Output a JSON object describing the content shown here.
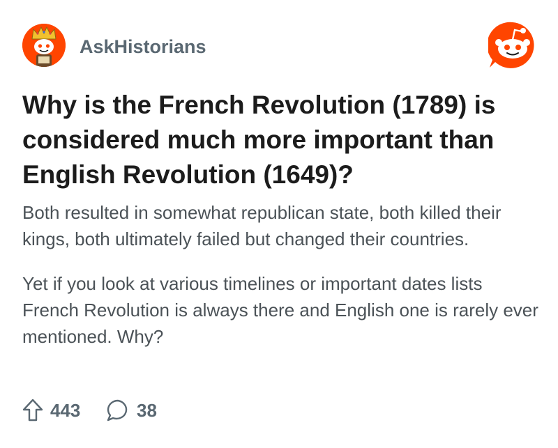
{
  "post": {
    "subreddit": "AskHistorians",
    "title": "Why is the French Revolution (1789) is considered much more important than English Revolution (1649)?",
    "body": [
      "Both resulted in somewhat republican state, both killed their kings, both ultimately failed but changed their countries.",
      "Yet if you look at various timelines or important dates lists French Revolution is always there and English one is rarely ever mentioned. Why?"
    ],
    "upvotes": "443",
    "comments": "38"
  },
  "icons": {
    "avatar": "askhistorians-avatar-icon",
    "logo": "reddit-logo-icon",
    "upvote": "upvote-arrow-icon",
    "comment": "comment-bubble-icon"
  },
  "colors": {
    "brand": "#ff4500",
    "meta_text": "#5a6872",
    "title_text": "#1c1c1c",
    "body_text": "#4b5257"
  }
}
